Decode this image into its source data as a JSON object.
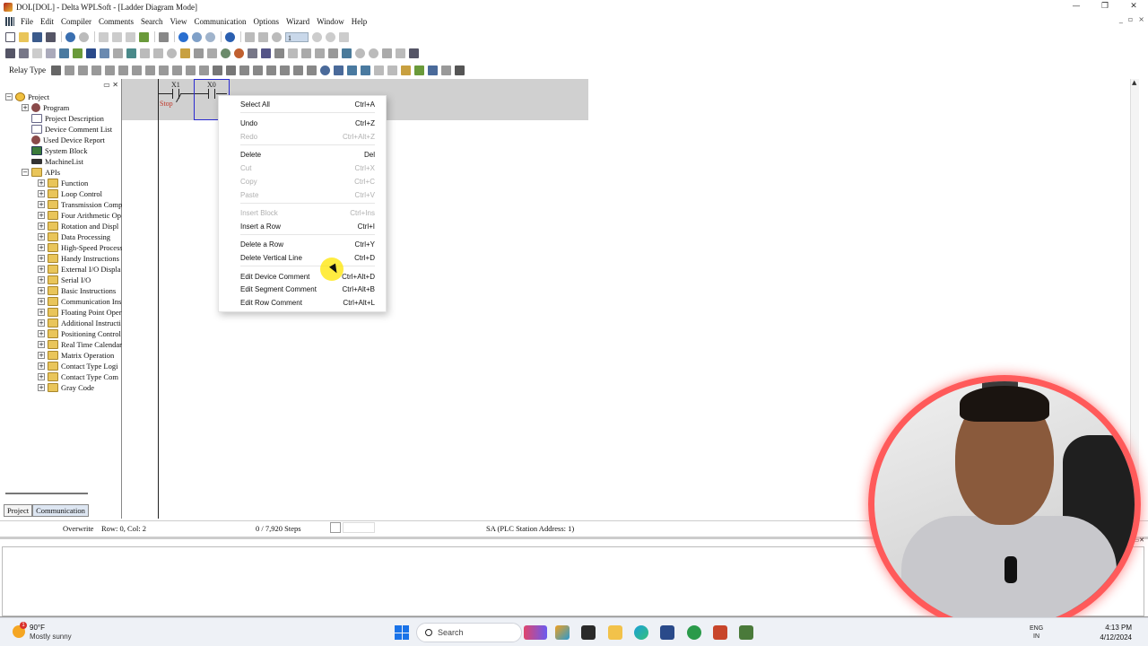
{
  "window": {
    "title": "DOL[DOL] - Delta WPLSoft - [Ladder Diagram Mode]"
  },
  "menu": {
    "items": [
      "File",
      "Edit",
      "Compiler",
      "Comments",
      "Search",
      "View",
      "Communication",
      "Options",
      "Wizard",
      "Window",
      "Help"
    ]
  },
  "toolbar": {
    "relay_type_label": "Relay Type",
    "step_value": "1"
  },
  "tree": {
    "root": "Project",
    "items": [
      {
        "label": "Program",
        "level": 1,
        "toggle": "+",
        "icon": "gear"
      },
      {
        "label": "Project Description",
        "level": 1,
        "toggle": "",
        "icon": "doc"
      },
      {
        "label": "Device Comment List",
        "level": 1,
        "toggle": "",
        "icon": "doc"
      },
      {
        "label": "Used Device Report",
        "level": 1,
        "toggle": "",
        "icon": "gear"
      },
      {
        "label": "System Block",
        "level": 1,
        "toggle": "",
        "icon": "sys"
      },
      {
        "label": "MachineList",
        "level": 1,
        "toggle": "",
        "icon": "mach"
      },
      {
        "label": "APIs",
        "level": 1,
        "toggle": "-",
        "icon": "folder"
      },
      {
        "label": "Function",
        "level": 2,
        "toggle": "+",
        "icon": "folder"
      },
      {
        "label": "Loop Control",
        "level": 2,
        "toggle": "+",
        "icon": "folder"
      },
      {
        "label": "Transmission Comp",
        "level": 2,
        "toggle": "+",
        "icon": "folder"
      },
      {
        "label": "Four Arithmetic Op",
        "level": 2,
        "toggle": "+",
        "icon": "folder"
      },
      {
        "label": "Rotation and Displ",
        "level": 2,
        "toggle": "+",
        "icon": "folder"
      },
      {
        "label": "Data Processing",
        "level": 2,
        "toggle": "+",
        "icon": "folder"
      },
      {
        "label": "High-Speed Process",
        "level": 2,
        "toggle": "+",
        "icon": "folder"
      },
      {
        "label": "Handy Instructions",
        "level": 2,
        "toggle": "+",
        "icon": "folder"
      },
      {
        "label": "External I/O Displa",
        "level": 2,
        "toggle": "+",
        "icon": "folder"
      },
      {
        "label": "Serial I/O",
        "level": 2,
        "toggle": "+",
        "icon": "folder"
      },
      {
        "label": "Basic Instructions",
        "level": 2,
        "toggle": "+",
        "icon": "folder"
      },
      {
        "label": "Communication Ins",
        "level": 2,
        "toggle": "+",
        "icon": "folder"
      },
      {
        "label": "Floating Point Oper",
        "level": 2,
        "toggle": "+",
        "icon": "folder"
      },
      {
        "label": "Additional Instructi",
        "level": 2,
        "toggle": "+",
        "icon": "folder"
      },
      {
        "label": "Positioning Control",
        "level": 2,
        "toggle": "+",
        "icon": "folder"
      },
      {
        "label": "Real Time Calendar",
        "level": 2,
        "toggle": "+",
        "icon": "folder"
      },
      {
        "label": "Matrix Operation",
        "level": 2,
        "toggle": "+",
        "icon": "folder"
      },
      {
        "label": "Contact Type Logi",
        "level": 2,
        "toggle": "+",
        "icon": "folder"
      },
      {
        "label": "Contact Type Com",
        "level": 2,
        "toggle": "+",
        "icon": "folder"
      },
      {
        "label": "Gray Code",
        "level": 2,
        "toggle": "+",
        "icon": "folder"
      }
    ],
    "tabs": [
      "Project",
      "Communication"
    ]
  },
  "ladder": {
    "contact1_label": "X1",
    "contact2_label": "X0",
    "comment": "Stop"
  },
  "context_menu": {
    "items": [
      {
        "label": "Select All",
        "shortcut": "Ctrl+A",
        "enabled": true
      },
      {
        "label": "Undo",
        "shortcut": "Ctrl+Z",
        "enabled": true
      },
      {
        "label": "Redo",
        "shortcut": "Ctrl+Alt+Z",
        "enabled": false
      },
      {
        "label": "Delete",
        "shortcut": "Del",
        "enabled": true
      },
      {
        "label": "Cut",
        "shortcut": "Ctrl+X",
        "enabled": false
      },
      {
        "label": "Copy",
        "shortcut": "Ctrl+C",
        "enabled": false
      },
      {
        "label": "Paste",
        "shortcut": "Ctrl+V",
        "enabled": false
      },
      {
        "label": "Insert Block",
        "shortcut": "Ctrl+Ins",
        "enabled": false
      },
      {
        "label": "Insert a Row",
        "shortcut": "Ctrl+I",
        "enabled": true
      },
      {
        "label": "Delete a Row",
        "shortcut": "Ctrl+Y",
        "enabled": true
      },
      {
        "label": "Delete Vertical Line",
        "shortcut": "Ctrl+D",
        "enabled": true
      },
      {
        "label": "Edit Device Comment",
        "shortcut": "Ctrl+Alt+D",
        "enabled": true
      },
      {
        "label": "Edit Segment Comment",
        "shortcut": "Ctrl+Alt+B",
        "enabled": true
      },
      {
        "label": "Edit Row Comment",
        "shortcut": "Ctrl+Alt+L",
        "enabled": true
      }
    ]
  },
  "status": {
    "mode": "Overwrite",
    "position": "Row: 0, Col: 2",
    "steps": "0 / 7,920 Steps",
    "station": "SA (PLC Station Address: 1)"
  },
  "taskbar": {
    "weather_badge": "1",
    "weather_temp": "90°F",
    "weather_desc": "Mostly sunny",
    "search_label": "Search",
    "lang_top": "ENG",
    "lang_bottom": "IN",
    "time": "4:13 PM",
    "date": "4/12/2024"
  },
  "colors": {
    "accent": "#2a2ad0",
    "rung_band": "#d0d0d0",
    "webcam_ring": "#ff5a5a",
    "comment_red": "#c0392b",
    "cursor_highlight": "#ffe600"
  }
}
